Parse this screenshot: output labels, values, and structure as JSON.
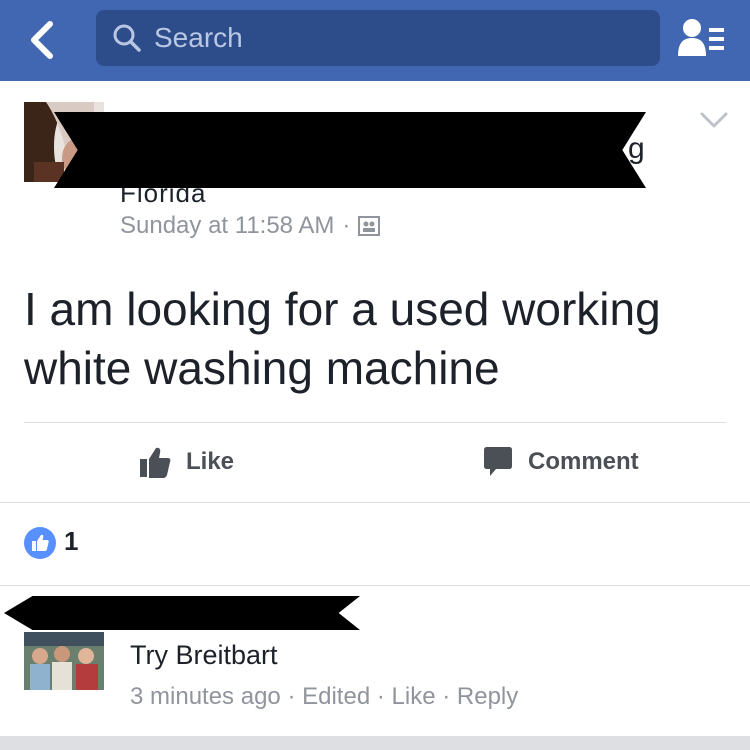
{
  "header": {
    "search_placeholder": "Search",
    "icons": {
      "back": "chevron-left-icon",
      "search": "search-icon",
      "friends": "friend-requests-icon"
    },
    "bar_color": "#4267b2"
  },
  "post": {
    "name_fragment_end": "g",
    "name_fragment_line2": "Florida",
    "timestamp": "Sunday at 11:58 AM",
    "separator": "·",
    "audience_icon": "group-audience-icon",
    "text": "I am looking for a used working white washing machine",
    "actions": {
      "like_label": "Like",
      "comment_label": "Comment"
    },
    "reactions": {
      "count": "1",
      "icon": "like-reaction-icon"
    }
  },
  "comment": {
    "text": "Try Breitbart",
    "time": "3 minutes ago",
    "edited": "Edited",
    "like": "Like",
    "reply": "Reply",
    "sep": "·"
  },
  "colors": {
    "meta_gray": "#90949c",
    "accent_blue": "#4267b2",
    "reaction_blue": "#5890ff"
  }
}
